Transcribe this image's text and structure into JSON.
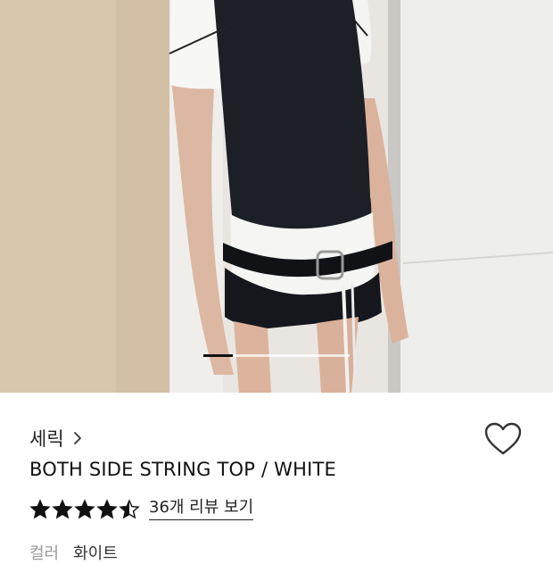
{
  "hero": {
    "image_alt": "Model wearing a black vest over a white top, black shorts and a black belt with white strings",
    "slide_progress": 0.2
  },
  "product": {
    "brand": "세릭",
    "name": "BOTH SIDE STRING TOP / WHITE",
    "rating": 4.5,
    "review_link": "36개 리뷰 보기",
    "option_label": "컬러",
    "option_value": "화이트"
  },
  "colors": {
    "star": "#111111",
    "text": "#111111",
    "muted": "#999999"
  },
  "icons": {
    "wishlist": "heart-outline-icon",
    "brand_link": "chevron-right-icon",
    "rating": "star-icon"
  }
}
